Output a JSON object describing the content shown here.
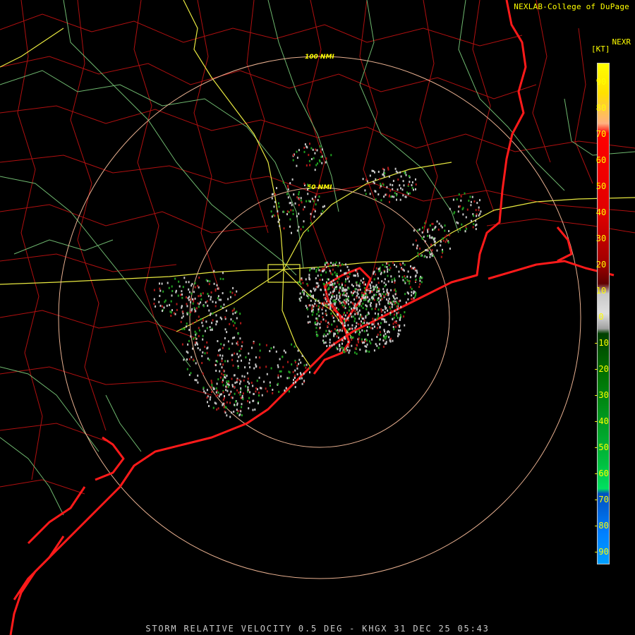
{
  "header": {
    "credit": "NEXLAB-College of DuPage",
    "product": "NEXR",
    "units": "[KT]"
  },
  "rings": [
    {
      "label": "100 NMI"
    },
    {
      "label": "50 NMI"
    }
  ],
  "legend": {
    "ticks": [
      "90",
      "80",
      "70",
      "60",
      "50",
      "40",
      "30",
      "20",
      "10",
      "0",
      "-10",
      "-20",
      "-30",
      "-40",
      "-50",
      "-60",
      "-70",
      "-80",
      "-90"
    ]
  },
  "footer": {
    "caption": "STORM RELATIVE VELOCITY 0.5 DEG - KHGX 31 DEC 25 05:43"
  },
  "colors": {
    "background": "#000000",
    "coastline": "#ff1a1a",
    "county_lines": "#b01010",
    "rivers": "#6fb86f",
    "highways": "#e8e840",
    "range_rings": "#e8b090",
    "text": "#ffff00",
    "footer_text": "#c8c8c8",
    "inbound": "#1fa01f",
    "outbound": "#b01818",
    "near_zero": "#c8c8c8"
  }
}
